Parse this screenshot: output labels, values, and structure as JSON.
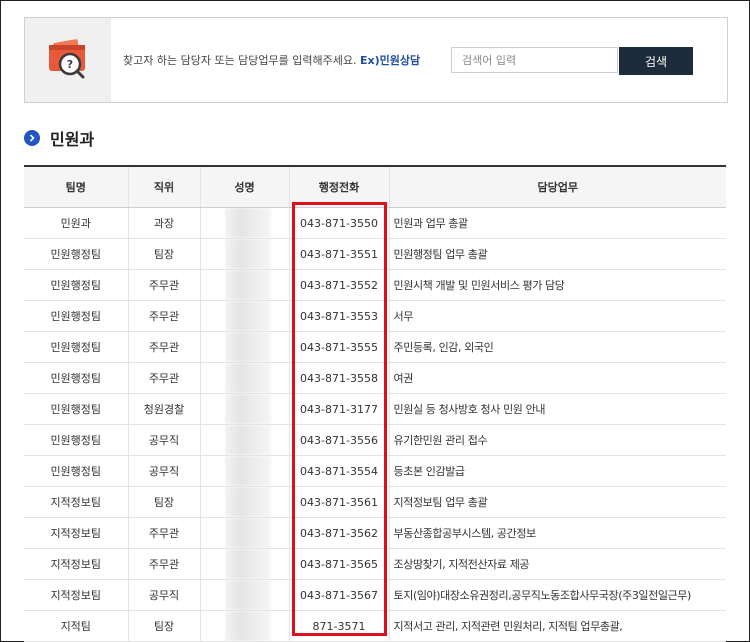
{
  "search": {
    "guide": "찾고자 하는 담당자 또는 담당업무를 입력해주세요.",
    "example": "Ex)민원상담",
    "placeholder": "검색어 입력",
    "button_label": "검색"
  },
  "section": {
    "title": "민원과"
  },
  "table": {
    "headers": [
      "팀명",
      "직위",
      "성명",
      "행정전화",
      "담당업무"
    ],
    "rows": [
      {
        "team": "민원과",
        "position": "과장",
        "phone": "043-871-3550",
        "duty": "민원과 업무 총괄"
      },
      {
        "team": "민원행정팀",
        "position": "팀장",
        "phone": "043-871-3551",
        "duty": "민원행정팀 업무 총괄"
      },
      {
        "team": "민원행정팀",
        "position": "주무관",
        "phone": "043-871-3552",
        "duty": "민원시책 개발 및 민원서비스 평가 담당"
      },
      {
        "team": "민원행정팀",
        "position": "주무관",
        "phone": "043-871-3553",
        "duty": "서무"
      },
      {
        "team": "민원행정팀",
        "position": "주무관",
        "phone": "043-871-3555",
        "duty": "주민등록, 인감, 외국인"
      },
      {
        "team": "민원행정팀",
        "position": "주무관",
        "phone": "043-871-3558",
        "duty": "여권"
      },
      {
        "team": "민원행정팀",
        "position": "청원경찰",
        "phone": "043-871-3177",
        "duty": "민원실 등 청사방호 청사 민원 안내"
      },
      {
        "team": "민원행정팀",
        "position": "공무직",
        "phone": "043-871-3556",
        "duty": "유기한민원 관리 접수"
      },
      {
        "team": "민원행정팀",
        "position": "공무직",
        "phone": "043-871-3554",
        "duty": "등초본 인감발급"
      },
      {
        "team": "지적정보팀",
        "position": "팀장",
        "phone": "043-871-3561",
        "duty": "지적정보팀 업무 총괄"
      },
      {
        "team": "지적정보팀",
        "position": "주무관",
        "phone": "043-871-3562",
        "duty": "부동산종합공부시스템, 공간정보"
      },
      {
        "team": "지적정보팀",
        "position": "주무관",
        "phone": "043-871-3565",
        "duty": "조상땅찾기, 지적전산자료 제공"
      },
      {
        "team": "지적정보팀",
        "position": "공무직",
        "phone": "043-871-3567",
        "duty": "토지(임야)대장소유권정리,공무직노동조합사무국장(주3일전일근무)"
      },
      {
        "team": "지적팀",
        "position": "팀장",
        "phone": "871-3571",
        "duty": "지적서고 관리, 지적관련 민원처리, 지적팀 업무총괄,"
      }
    ]
  },
  "colors": {
    "highlight": "#e0101a",
    "button_bg": "#1e2b3a",
    "accent": "#1f56c4",
    "example_text": "#1f4ea3"
  },
  "icons": {
    "search_panel": "wallet-search-icon",
    "section_bullet": "chevron-right-icon"
  }
}
